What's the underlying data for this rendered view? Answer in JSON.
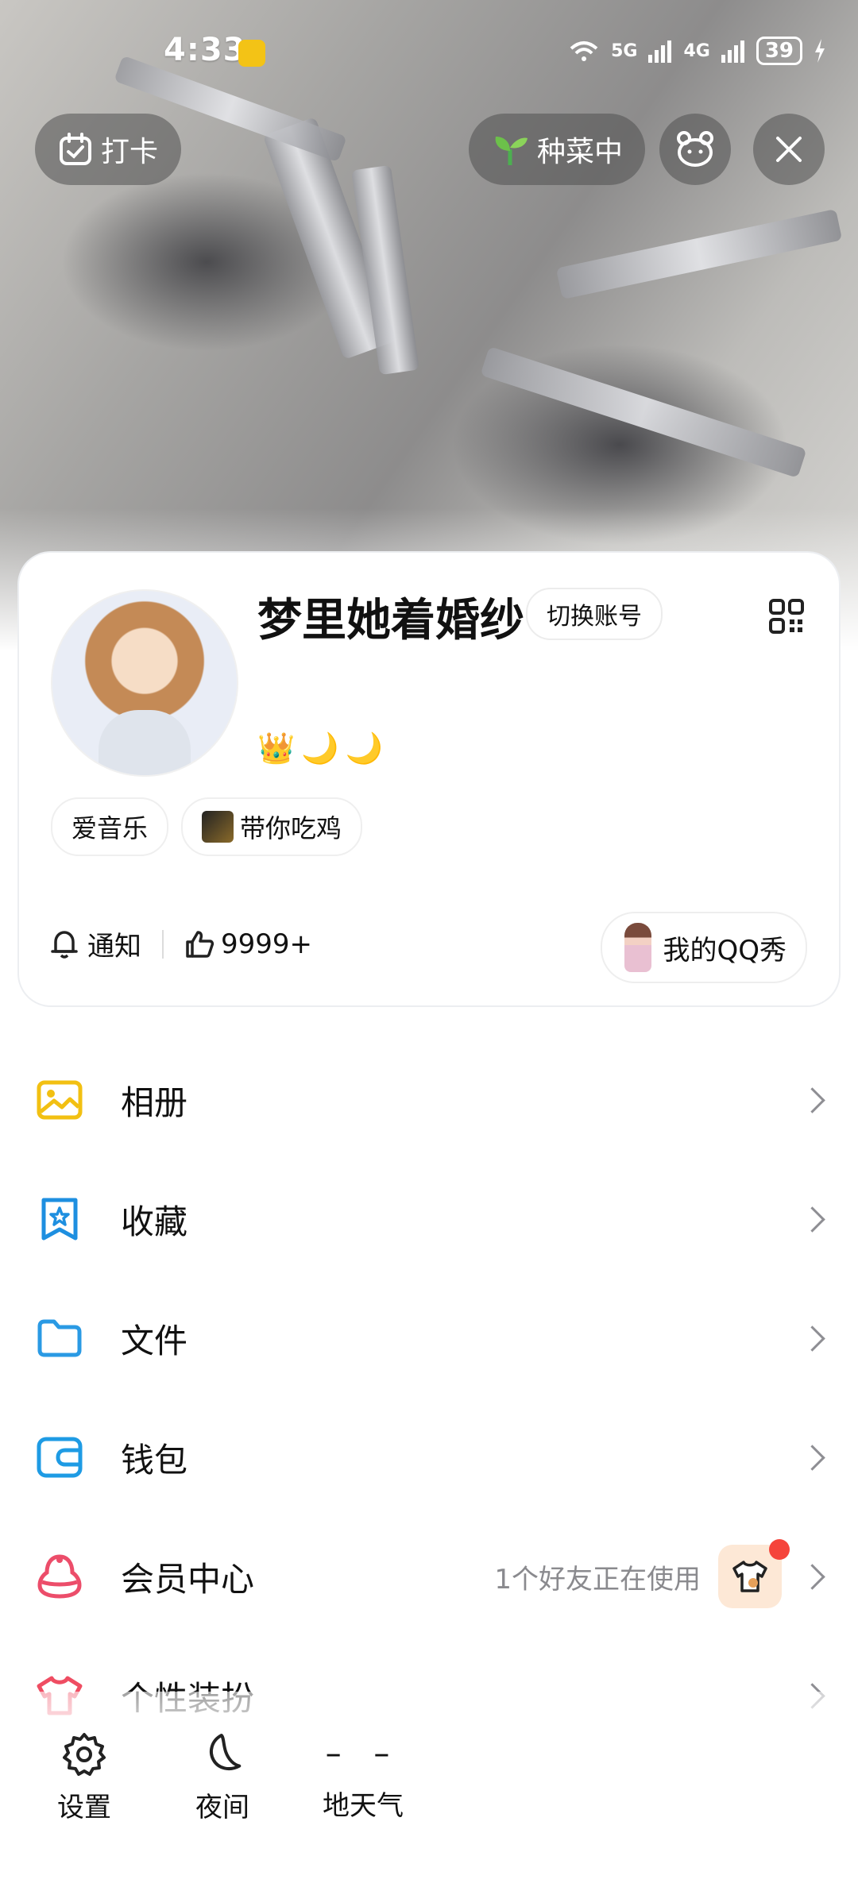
{
  "status_bar": {
    "time": "4:33",
    "network1": "5G",
    "network2": "4G",
    "battery": "39"
  },
  "top_actions": {
    "checkin": "打卡",
    "garden": "种菜中"
  },
  "profile": {
    "nickname": "梦里她着婚纱",
    "switch_account": "切换账号",
    "badges": [
      "👑",
      "🌙",
      "🌙"
    ],
    "tags": [
      "爱音乐",
      "带你吃鸡"
    ],
    "notify": "通知",
    "likes": "9999+",
    "qq_show": "我的QQ秀"
  },
  "menu": {
    "items": [
      {
        "label": "相册"
      },
      {
        "label": "收藏"
      },
      {
        "label": "文件"
      },
      {
        "label": "钱包"
      },
      {
        "label": "会员中心",
        "note": "1个好友正在使用"
      },
      {
        "label": "个性装扮"
      }
    ]
  },
  "bottom_bar": {
    "settings": "设置",
    "night": "夜间",
    "weather_value": "– –",
    "weather": "地天气"
  },
  "colors": {
    "album": "#f2c012",
    "favorites": "#1e8fe0",
    "files": "#2a9ae4",
    "wallet": "#1e9be4",
    "member": "#ec4d6a",
    "theme": "#ef4d62"
  }
}
